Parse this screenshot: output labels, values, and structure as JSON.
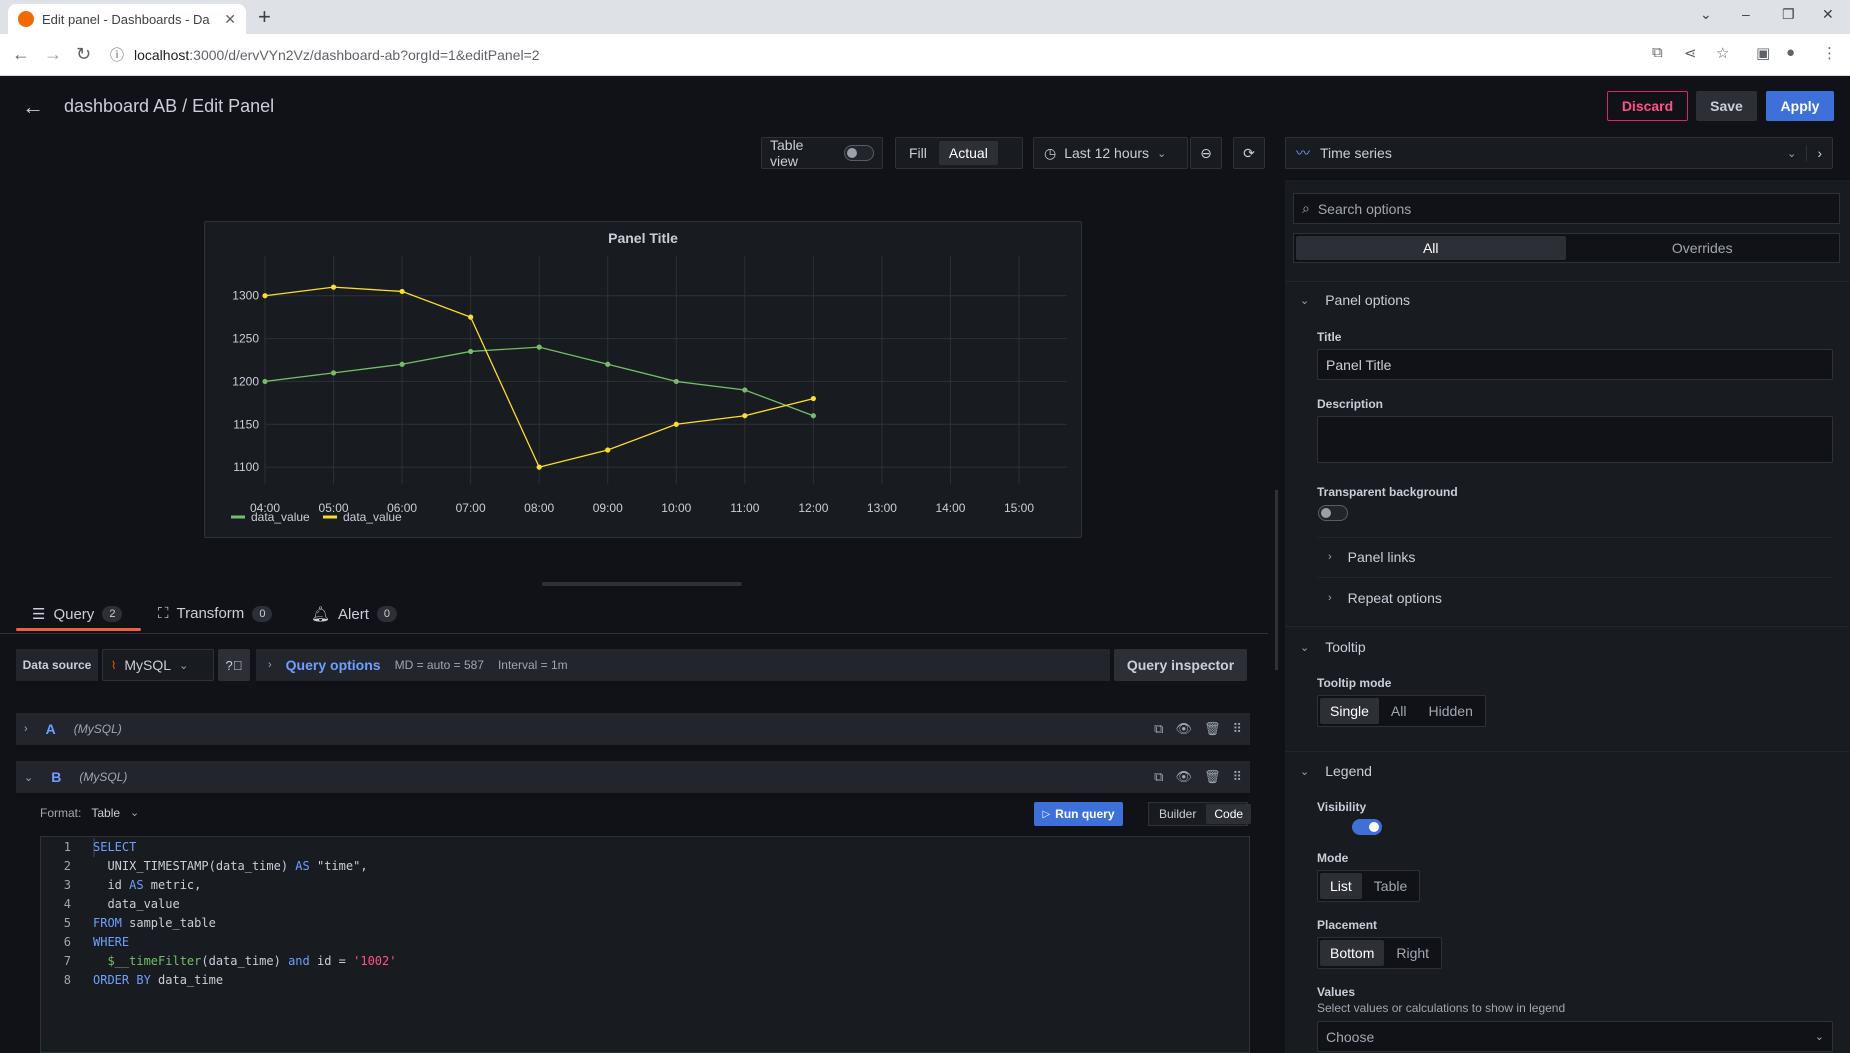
{
  "browser": {
    "tab_title": "Edit panel - Dashboards - Da",
    "url_host": "localhost",
    "url_path": ":3000/d/ervVYn2Vz/dashboard-ab?orgId=1&editPanel=2"
  },
  "header": {
    "title": "dashboard AB / Edit Panel",
    "discard": "Discard",
    "save": "Save",
    "apply": "Apply"
  },
  "toolbar": {
    "table_view": "Table view",
    "fill": "Fill",
    "actual": "Actual",
    "time_range": "Last 12 hours",
    "viz": "Time series"
  },
  "panel": {
    "title": "Panel Title"
  },
  "chart_data": {
    "type": "line",
    "title": "Panel Title",
    "x": [
      "04:00",
      "05:00",
      "06:00",
      "07:00",
      "08:00",
      "09:00",
      "10:00",
      "11:00",
      "12:00"
    ],
    "x_ticks": [
      "04:00",
      "05:00",
      "06:00",
      "07:00",
      "08:00",
      "09:00",
      "10:00",
      "11:00",
      "12:00",
      "13:00",
      "14:00",
      "15:00"
    ],
    "y_ticks": [
      1100,
      1150,
      1200,
      1250,
      1300
    ],
    "ylim": [
      1085,
      1330
    ],
    "grid": true,
    "legend_position": "bottom-left",
    "series": [
      {
        "name": "data_value",
        "color": "#73bf69",
        "values": [
          1200,
          1210,
          1220,
          1235,
          1240,
          1220,
          1200,
          1190,
          1160
        ]
      },
      {
        "name": "data_value",
        "color": "#fade2a",
        "values": [
          1300,
          1310,
          1305,
          1275,
          1100,
          1120,
          1150,
          1160,
          1180
        ]
      }
    ]
  },
  "query_tabs": [
    {
      "label": "Query",
      "count": "2"
    },
    {
      "label": "Transform",
      "count": "0"
    },
    {
      "label": "Alert",
      "count": "0"
    }
  ],
  "datasource": {
    "label": "Data source",
    "name": "MySQL",
    "query_options": "Query options",
    "md": "MD = auto = 587",
    "interval": "Interval = 1m",
    "inspector": "Query inspector"
  },
  "queries": [
    {
      "ref": "A",
      "ds": "(MySQL)"
    },
    {
      "ref": "B",
      "ds": "(MySQL)"
    }
  ],
  "editor": {
    "format_label": "Format:",
    "format_value": "Table",
    "run": "Run query",
    "builder": "Builder",
    "code": "Code",
    "lines": [
      "1",
      "2",
      "3",
      "4",
      "5",
      "6",
      "7",
      "8"
    ]
  },
  "options": {
    "search_placeholder": "Search options",
    "all": "All",
    "overrides": "Overrides",
    "panel_options": "Panel options",
    "title_label": "Title",
    "title_value": "Panel Title",
    "description_label": "Description",
    "transparent_label": "Transparent background",
    "panel_links": "Panel links",
    "repeat_options": "Repeat options",
    "tooltip": "Tooltip",
    "tooltip_mode_label": "Tooltip mode",
    "tooltip_modes": [
      "Single",
      "All",
      "Hidden"
    ],
    "legend": "Legend",
    "visibility_label": "Visibility",
    "mode_label": "Mode",
    "modes": [
      "List",
      "Table"
    ],
    "placement_label": "Placement",
    "placements": [
      "Bottom",
      "Right"
    ],
    "values_label": "Values",
    "values_sub": "Select values or calculations to show in legend",
    "values_placeholder": "Choose"
  }
}
